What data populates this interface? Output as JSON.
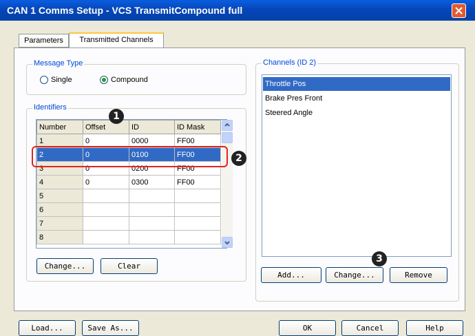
{
  "window": {
    "title": "CAN 1 Comms Setup - VCS TransmitCompound full"
  },
  "tabs": [
    {
      "label": "Parameters",
      "active": false
    },
    {
      "label": "Transmitted Channels",
      "active": true
    }
  ],
  "message_type": {
    "legend": "Message Type",
    "options": [
      {
        "label": "Single",
        "selected": false
      },
      {
        "label": "Compound",
        "selected": true
      }
    ]
  },
  "identifiers": {
    "legend": "Identifiers",
    "columns": [
      "Number",
      "Offset",
      "ID",
      "ID Mask"
    ],
    "rows": [
      {
        "number": "1",
        "offset": "0",
        "id": "0000",
        "mask": "FF00"
      },
      {
        "number": "2",
        "offset": "0",
        "id": "0100",
        "mask": "FF00"
      },
      {
        "number": "3",
        "offset": "0",
        "id": "0200",
        "mask": "FF00"
      },
      {
        "number": "4",
        "offset": "0",
        "id": "0300",
        "mask": "FF00"
      },
      {
        "number": "5",
        "offset": "",
        "id": "",
        "mask": ""
      },
      {
        "number": "6",
        "offset": "",
        "id": "",
        "mask": ""
      },
      {
        "number": "7",
        "offset": "",
        "id": "",
        "mask": ""
      },
      {
        "number": "8",
        "offset": "",
        "id": "",
        "mask": ""
      }
    ],
    "selected_row": "2",
    "change_label": "Change...",
    "clear_label": "Clear"
  },
  "channels": {
    "legend": "Channels (ID 2)",
    "items": [
      "Throttle Pos",
      "Brake Pres Front",
      "Steered Angle"
    ],
    "selected": "Throttle Pos",
    "add_label": "Add...",
    "change_label": "Change...",
    "remove_label": "Remove"
  },
  "footer": {
    "load_label": "Load...",
    "save_as_label": "Save As...",
    "ok_label": "OK",
    "cancel_label": "Cancel",
    "help_label": "Help"
  },
  "callouts": [
    "1",
    "2",
    "3"
  ],
  "colors": {
    "titlebar": "#0646b8",
    "selection": "#316ac5",
    "group_legend": "#0046d5",
    "highlight": "#e0231f"
  },
  "icons": {
    "close": "close-icon",
    "scroll_up": "chevron-up-icon",
    "scroll_down": "chevron-down-icon"
  }
}
